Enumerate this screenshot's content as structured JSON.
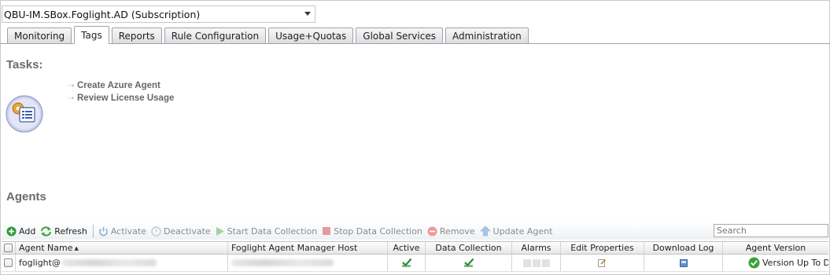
{
  "subscription": {
    "selected": "QBU-IM.SBox.Foglight.AD (Subscription)"
  },
  "tabs": [
    {
      "label": "Monitoring",
      "active": false
    },
    {
      "label": "Tags",
      "active": true
    },
    {
      "label": "Reports",
      "active": false
    },
    {
      "label": "Rule Configuration",
      "active": false
    },
    {
      "label": "Usage+Quotas",
      "active": false
    },
    {
      "label": "Global Services",
      "active": false
    },
    {
      "label": "Administration",
      "active": false
    }
  ],
  "tasks": {
    "title": "Tasks:",
    "items": [
      {
        "label": "Create Azure Agent"
      },
      {
        "label": "Review License Usage"
      }
    ]
  },
  "agents": {
    "title": "Agents",
    "toolbar": {
      "add": "Add",
      "refresh": "Refresh",
      "activate": "Activate",
      "deactivate": "Deactivate",
      "start_collection": "Start Data Collection",
      "stop_collection": "Stop Data Collection",
      "remove": "Remove",
      "update": "Update Agent"
    },
    "search_placeholder": "Search",
    "columns": {
      "agent_name": "Agent Name",
      "manager_host": "Foglight Agent Manager Host",
      "active": "Active",
      "data_collection": "Data Collection",
      "alarms": "Alarms",
      "edit_properties": "Edit Properties",
      "download_log": "Download Log",
      "agent_version": "Agent Version"
    },
    "rows": [
      {
        "agent_name": "foglight@",
        "agent_version": "Version Up To Date"
      }
    ]
  },
  "colors": {
    "accent_green": "#3aa33a",
    "tab_border": "#9aa3ad",
    "section_title": "#6b6b6b"
  }
}
